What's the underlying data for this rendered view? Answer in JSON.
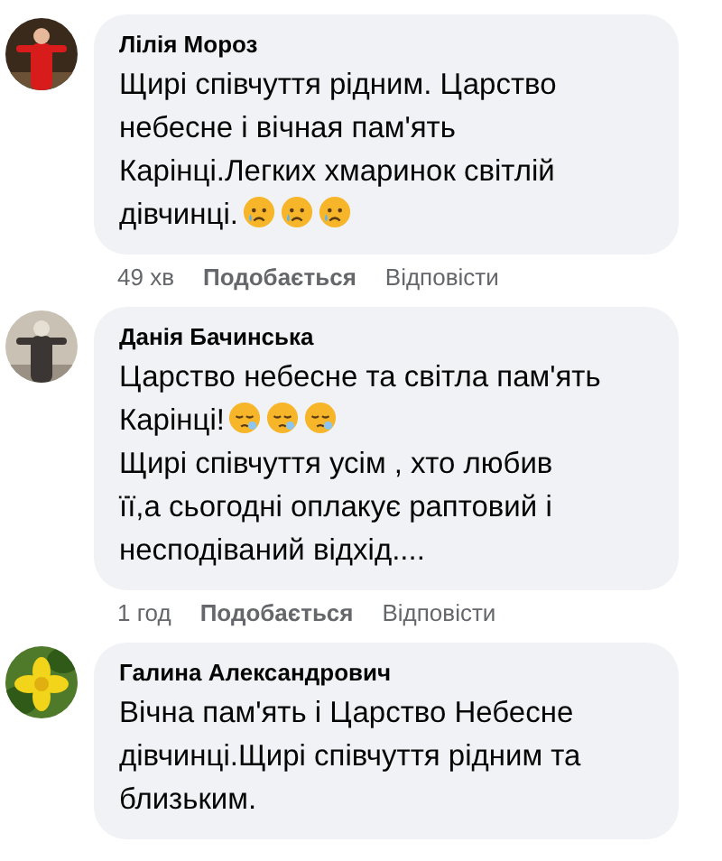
{
  "comments": [
    {
      "avatar": {
        "kind": "picture"
      },
      "name": "Лілія Мороз",
      "paragraphs": [
        {
          "lines": [
            "Щирі співчуття рідним. Царство",
            "небесне і вічная пам'ять",
            "Карінці.Легких хмаринок світлій",
            "дівчинці."
          ],
          "emojis": [
            {
              "kind": "crying"
            },
            {
              "kind": "crying"
            },
            {
              "kind": "crying"
            }
          ]
        }
      ],
      "time": "49 хв",
      "like": "Подобається",
      "reply": "Відповісти"
    },
    {
      "avatar": {
        "kind": "picture"
      },
      "name": "Данія Бачинська",
      "paragraphs": [
        {
          "lines": [
            "Царство небесне та світла пам'ять",
            "Карінці!"
          ],
          "emojis": [
            {
              "kind": "sleepy"
            },
            {
              "kind": "sleepy"
            },
            {
              "kind": "sleepy"
            }
          ]
        },
        {
          "lines": [
            "Щирі співчуття усім , хто любив",
            "її,а сьогодні оплакує раптовий і",
            "несподіваний відхід...."
          ]
        }
      ],
      "time": "1 год",
      "like": "Подобається",
      "reply": "Відповісти"
    },
    {
      "avatar": {
        "kind": "picture"
      },
      "name": "Галина Александрович",
      "paragraphs": [
        {
          "lines": [
            "Вічна пам'ять і Царство Небесне",
            "дівчинці.Щирі співчуття рідним та",
            "близьким."
          ]
        }
      ]
    }
  ]
}
